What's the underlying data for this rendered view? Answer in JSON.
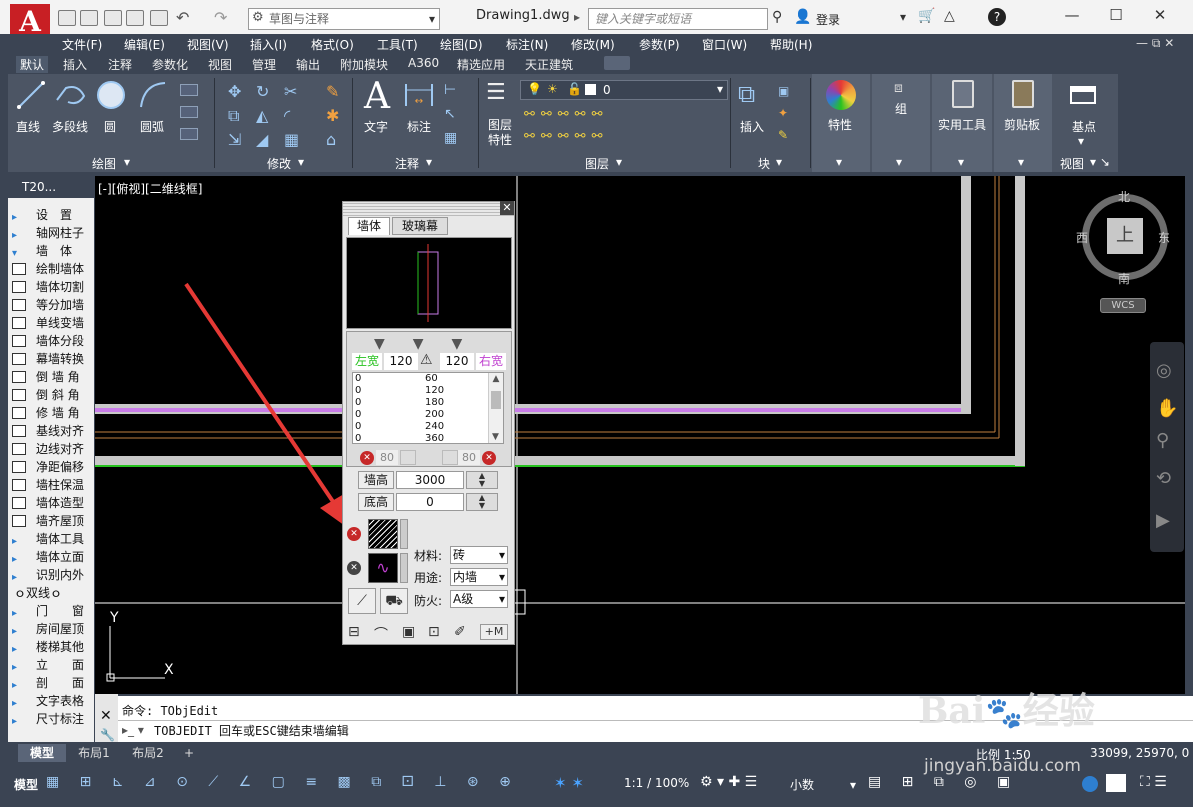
{
  "app": {
    "doc_title": "Drawing1.dwg",
    "workspace": "草图与注释",
    "search_placeholder": "键入关键字或短语",
    "login": "登录"
  },
  "menu": [
    "文件(F)",
    "编辑(E)",
    "视图(V)",
    "插入(I)",
    "格式(O)",
    "工具(T)",
    "绘图(D)",
    "标注(N)",
    "修改(M)",
    "参数(P)",
    "窗口(W)",
    "帮助(H)"
  ],
  "ribbon_tabs": [
    "默认",
    "插入",
    "注释",
    "参数化",
    "视图",
    "管理",
    "输出",
    "附加模块",
    "A360",
    "精选应用",
    "天正建筑"
  ],
  "ribbon": {
    "draw_tools": [
      "直线",
      "多段线",
      "圆",
      "圆弧"
    ],
    "draw_panel": "绘图",
    "modify_panel": "修改",
    "annot_tools": [
      "文字",
      "标注"
    ],
    "annot_panel": "注释",
    "layer_btn": "图层\n特性",
    "layer_value": "0",
    "layer_panel": "图层",
    "insert": "插入",
    "block_panel": "块",
    "properties": "特性",
    "group": "组",
    "utilities": "实用工具",
    "clipboard": "剪贴板",
    "basepoint": "基点",
    "view_panel": "视图"
  },
  "viewport": {
    "label": "[-][俯视][二维线框]",
    "compass": {
      "n": "北",
      "s": "南",
      "e": "东",
      "w": "西",
      "center": "上"
    },
    "wcs": "WCS",
    "axis_x": "X",
    "axis_y": "Y"
  },
  "tianzheng": {
    "header": "T20...",
    "items": [
      {
        "label": "设　置",
        "type": "section"
      },
      {
        "label": "轴网柱子",
        "type": "section"
      },
      {
        "label": "墙　体",
        "type": "section"
      },
      {
        "label": "绘制墙体",
        "type": "tool"
      },
      {
        "label": "墙体切割",
        "type": "tool"
      },
      {
        "label": "等分加墙",
        "type": "tool"
      },
      {
        "label": "单线变墙",
        "type": "tool"
      },
      {
        "label": "墙体分段",
        "type": "tool"
      },
      {
        "label": "幕墙转换",
        "type": "tool"
      },
      {
        "label": "倒 墙 角",
        "type": "tool"
      },
      {
        "label": "倒 斜 角",
        "type": "tool"
      },
      {
        "label": "修 墙 角",
        "type": "tool"
      },
      {
        "label": "基线对齐",
        "type": "tool"
      },
      {
        "label": "边线对齐",
        "type": "tool"
      },
      {
        "label": "净距偏移",
        "type": "tool"
      },
      {
        "label": "墙柱保温",
        "type": "tool"
      },
      {
        "label": "墙体造型",
        "type": "tool"
      },
      {
        "label": "墙齐屋顶",
        "type": "tool"
      },
      {
        "label": "墙体工具",
        "type": "section"
      },
      {
        "label": "墙体立面",
        "type": "section"
      },
      {
        "label": "识别内外",
        "type": "section"
      },
      {
        "label": "ｏ双线ｏ",
        "type": "divider"
      },
      {
        "label": "门　　窗",
        "type": "section"
      },
      {
        "label": "房间屋顶",
        "type": "section"
      },
      {
        "label": "楼梯其他",
        "type": "section"
      },
      {
        "label": "立　　面",
        "type": "section"
      },
      {
        "label": "剖　　面",
        "type": "section"
      },
      {
        "label": "文字表格",
        "type": "section"
      },
      {
        "label": "尺寸标注",
        "type": "section"
      }
    ]
  },
  "wall_dialog": {
    "tabs": [
      "墙体",
      "玻璃幕"
    ],
    "left_label": "左宽",
    "right_label": "右宽",
    "left_width": "120",
    "right_width": "120",
    "width_rows": [
      {
        "a": "0",
        "b": "60"
      },
      {
        "a": "0",
        "b": "120"
      },
      {
        "a": "0",
        "b": "180"
      },
      {
        "a": "0",
        "b": "200"
      },
      {
        "a": "0",
        "b": "240"
      },
      {
        "a": "0",
        "b": "360"
      }
    ],
    "offset_left": "80",
    "offset_right": "80",
    "height_label": "墙高",
    "height_value": "3000",
    "base_label": "底高",
    "base_value": "0",
    "material_label": "材料:",
    "material_value": "砖",
    "usage_label": "用途:",
    "usage_value": "内墙",
    "fire_label": "防火:",
    "fire_value": "A级",
    "bottom_btn": "+M"
  },
  "command": {
    "history": "命令: TObjEdit",
    "current": "TOBJEDIT 回车或ESC键结束墙编辑"
  },
  "layouts": [
    "模型",
    "布局1",
    "布局2"
  ],
  "status": {
    "model": "模型",
    "scale": "比例 1:50",
    "coords": "33099, 25970, 0",
    "anno_scale": "1:1 / 100%",
    "units": "小数"
  },
  "watermark": {
    "brand": "Bai",
    "brand2": "经验",
    "url": "jingyan.baidu.com"
  },
  "colors": {
    "accent": "#c81f24",
    "wall_magenta": "#c87ce8",
    "wall_green": "#27c21f",
    "wall_grey": "#c8c8c8",
    "arrow": "#e53935"
  }
}
